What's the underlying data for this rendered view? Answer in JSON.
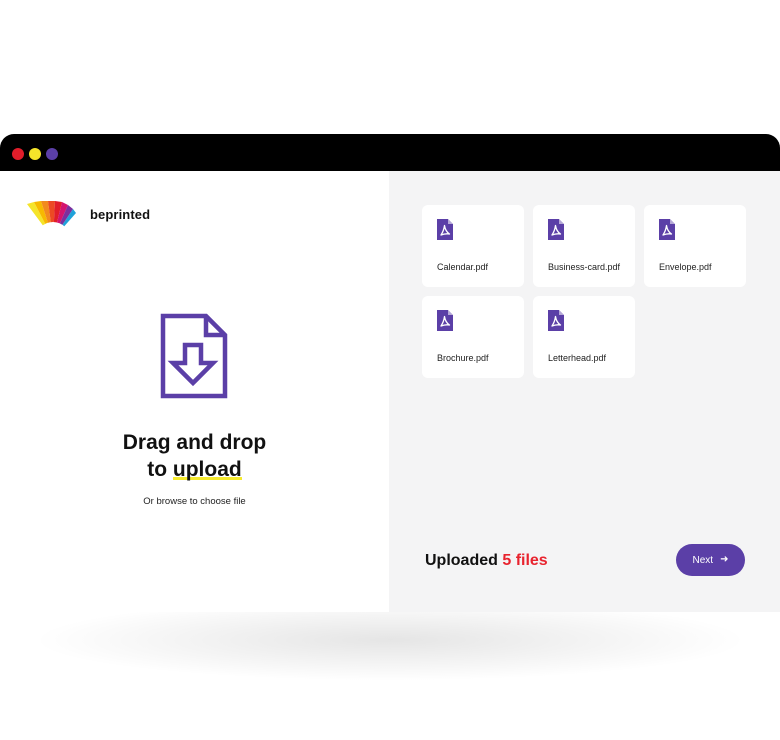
{
  "colors": {
    "titlebar": "#000000",
    "dot_red": "#e11d2a",
    "dot_yellow": "#f5e42a",
    "dot_purple": "#5b3fa7",
    "accent_purple": "#5b3fa7",
    "accent_red": "#e8232e",
    "highlight_yellow": "#f5ea2e"
  },
  "brand": {
    "name": "beprinted",
    "logo": "rainbow-fan-logo"
  },
  "dropzone": {
    "icon": "file-download-icon",
    "headline_line1": "Drag and drop",
    "headline_line2_prefix": "to ",
    "headline_line2_highlight": "upload",
    "browse_text": "Or browse to choose file"
  },
  "files": [
    {
      "name": "Calendar.pdf",
      "icon": "pdf-icon"
    },
    {
      "name": "Business-card.pdf",
      "icon": "pdf-icon"
    },
    {
      "name": "Envelope.pdf",
      "icon": "pdf-icon"
    },
    {
      "name": "Brochure.pdf",
      "icon": "pdf-icon"
    },
    {
      "name": "Letterhead.pdf",
      "icon": "pdf-icon"
    }
  ],
  "status": {
    "prefix": "Uploaded ",
    "count": "5 files"
  },
  "next_button": {
    "label": "Next",
    "icon": "arrow-right-icon"
  }
}
